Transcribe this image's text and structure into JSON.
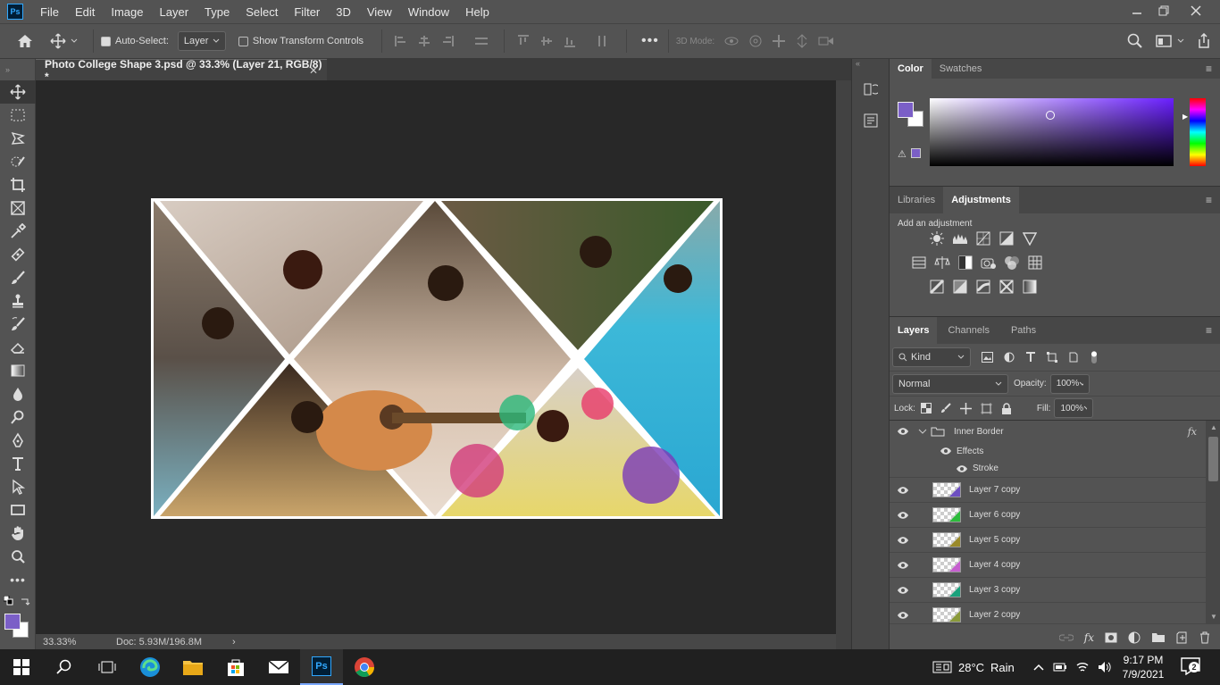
{
  "app": {
    "logo": "Ps"
  },
  "menu": [
    "File",
    "Edit",
    "Image",
    "Layer",
    "Type",
    "Select",
    "Filter",
    "3D",
    "View",
    "Window",
    "Help"
  ],
  "options": {
    "auto_select_label": "Auto-Select:",
    "auto_select_value": "Layer",
    "show_transform_label": "Show Transform Controls",
    "mode_3d_label": "3D Mode:"
  },
  "document": {
    "tab_title": "Photo College Shape  3.psd @ 33.3% (Layer 21, RGB/8) *",
    "zoom": "33.33%",
    "doc_size": "Doc: 5.93M/196.8M"
  },
  "colors": {
    "foreground": "#7b5fc7",
    "background": "#ffffff",
    "picker_hue": "#6a1fff"
  },
  "color_panel": {
    "tabs": [
      "Color",
      "Swatches"
    ],
    "active": 0
  },
  "adjust_panel": {
    "tabs": [
      "Libraries",
      "Adjustments"
    ],
    "active": 1,
    "hint": "Add an adjustment"
  },
  "layers_panel": {
    "tabs": [
      "Layers",
      "Channels",
      "Paths"
    ],
    "active": 0,
    "filter_kind": "Kind",
    "blend_mode": "Normal",
    "opacity_label": "Opacity:",
    "opacity": "100%",
    "lock_label": "Lock:",
    "fill_label": "Fill:",
    "fill": "100%",
    "group": {
      "name": "Inner Border",
      "fx": "fx",
      "effects_label": "Effects",
      "stroke_label": "Stroke"
    },
    "layers": [
      {
        "name": "Layer 7 copy",
        "tint": "#6d4fc1"
      },
      {
        "name": "Layer 6 copy",
        "tint": "#2dbb3c"
      },
      {
        "name": "Layer 5 copy",
        "tint": "#9a8a2a"
      },
      {
        "name": "Layer 4 copy",
        "tint": "#c65fcf"
      },
      {
        "name": "Layer 3 copy",
        "tint": "#1aa27c"
      },
      {
        "name": "Layer 2 copy",
        "tint": "#8a9a3a"
      }
    ]
  },
  "taskbar": {
    "weather_temp": "28°C",
    "weather_desc": "Rain",
    "time": "9:17 PM",
    "date": "7/9/2021",
    "notifications": "2",
    "ps_label": "Ps"
  }
}
